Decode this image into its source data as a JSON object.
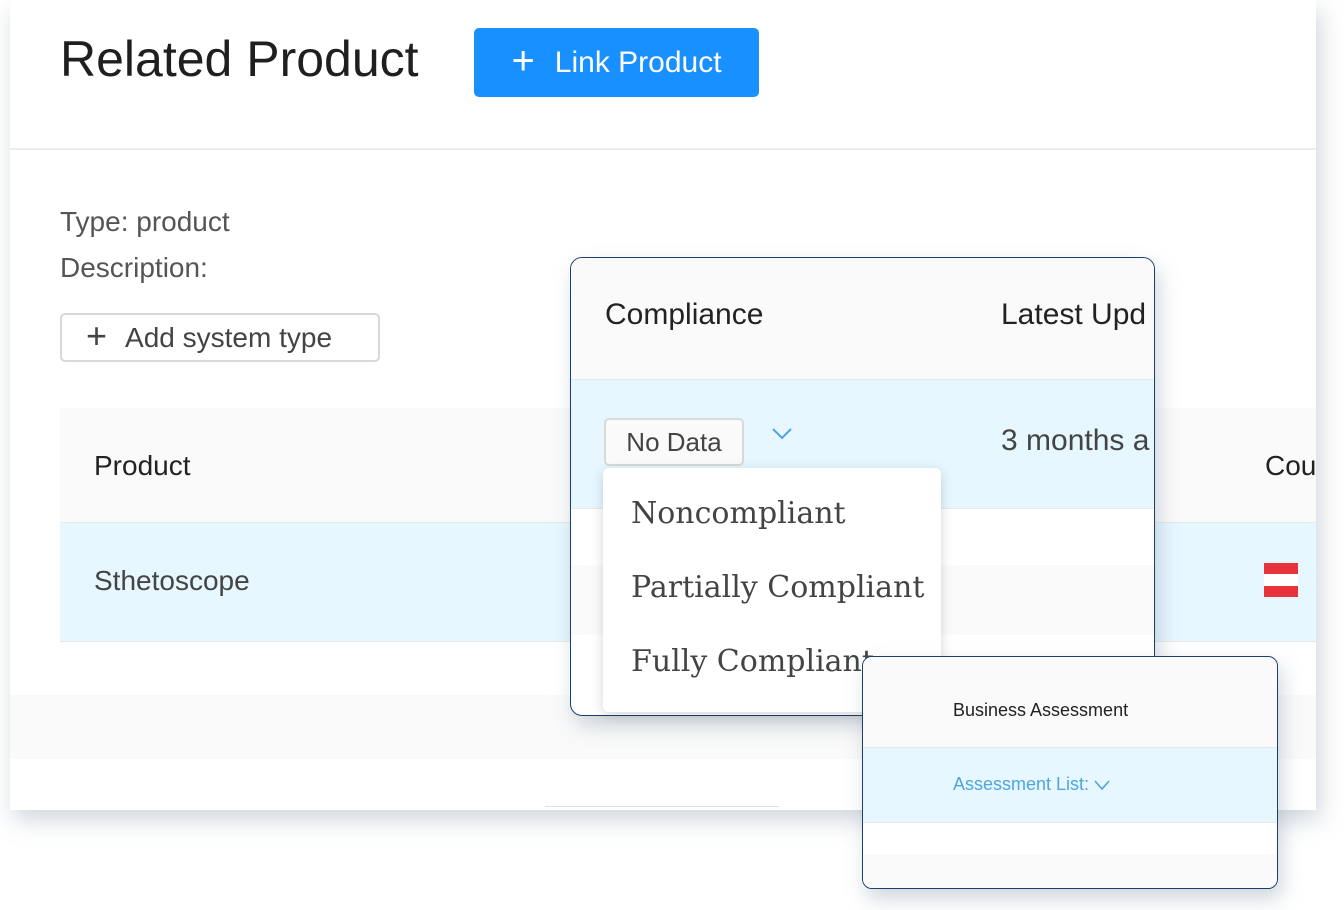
{
  "header": {
    "title": "Related Product",
    "link_button_label": "Link Product"
  },
  "details": {
    "type_line": "Type: product",
    "description_line": "Description:",
    "add_system_type_label": "Add system type"
  },
  "product_table": {
    "columns": [
      "Product",
      "Cou"
    ],
    "rows": [
      {
        "product": "Sthetoscope",
        "country_flag_colors": [
          "#e8323c",
          "#ffffff",
          "#e8323c"
        ]
      }
    ]
  },
  "compliance_panel": {
    "columns": [
      "Compliance",
      "Latest Upd"
    ],
    "selected_value": "No Data",
    "latest_update": "3 months a",
    "options": [
      "Noncompliant",
      "Partially Compliant",
      "Fully Compliant"
    ]
  },
  "assessment_panel": {
    "column": "Business Assessment",
    "link_label": "Assessment List:"
  },
  "colors": {
    "primary": "#1890ff",
    "row_highlight": "#e6f7ff",
    "panel_border": "#1b3f6b",
    "link": "#4ea6dc"
  },
  "icons": {
    "plus": "plus-icon",
    "chevron": "chevron-down-icon"
  }
}
